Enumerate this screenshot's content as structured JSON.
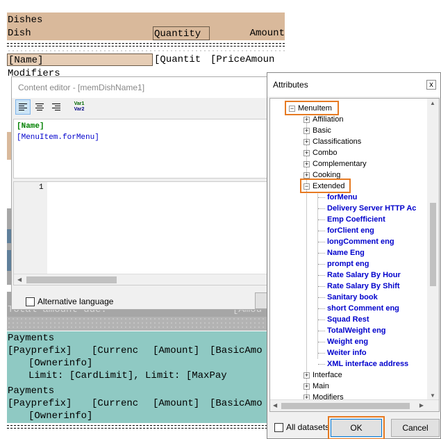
{
  "report": {
    "dishes_header": "Dishes",
    "col_dish": "Dish",
    "col_quantity": "Quantity",
    "col_amount": "Amount",
    "field_name": "[Name]",
    "field_quantity": "[Quantit",
    "field_price": "[PriceAmoun",
    "modifiers": "Modifiers",
    "total_due": "Total amount due:",
    "amount_fragment": "[Amou",
    "payments_1": {
      "title": "Payments",
      "row1_prefix": "[Payprefix]",
      "row1_currency": "[Currenc",
      "row1_amount": "[Amount]",
      "row1_basic": "[BasicAmo",
      "ownerinfo": "[Ownerinfo]",
      "limit_text": "Limit: [CardLimit], Limit: [MaxPay"
    },
    "payments_2": {
      "title": "Payments",
      "row1_prefix": "[Payprefix]",
      "row1_currency": "[Currenc",
      "row1_amount": "[Amount]",
      "row1_basic": "[BasicAmo",
      "ownerinfo": "[Ownerinfo]"
    }
  },
  "content_editor": {
    "title": "Content editor - [memDishName1]",
    "toolbar": {
      "var_top": "Var1",
      "var_bottom": "Var2"
    },
    "code_line1": "[Name]",
    "code_line2": "[MenuItem.forMenu]",
    "line_number": "1",
    "alternative_language": "Alternative language"
  },
  "attributes": {
    "title": "Attributes",
    "close": "x",
    "root": "MenuItem",
    "nodes_before": [
      "Affiliation",
      "Basic",
      "Classifications",
      "Combo",
      "Complementary",
      "Cooking"
    ],
    "extended": "Extended",
    "extended_children": [
      "forMenu",
      "Delivery Server HTTP Ac",
      "Emp Coefficient",
      "forClient eng",
      "longComment eng",
      "Name Eng",
      "prompt eng",
      "Rate Salary By Hour",
      "Rate Salary By Shift",
      "Sanitary book",
      "short Comment eng",
      "Squad Rest",
      "TotalWeight eng",
      "Weight eng",
      "Weiter info",
      "XML interface address"
    ],
    "nodes_after": [
      "Interface",
      "Main",
      "Modifiers"
    ],
    "all_datasets": "All datasets",
    "ok": "OK",
    "cancel": "Cancel"
  },
  "colors": {
    "highlight": "#e67a22",
    "leaf_text": "#0000cc",
    "tan_band": "#d9b99b",
    "teal_band": "#8fc9c3"
  }
}
